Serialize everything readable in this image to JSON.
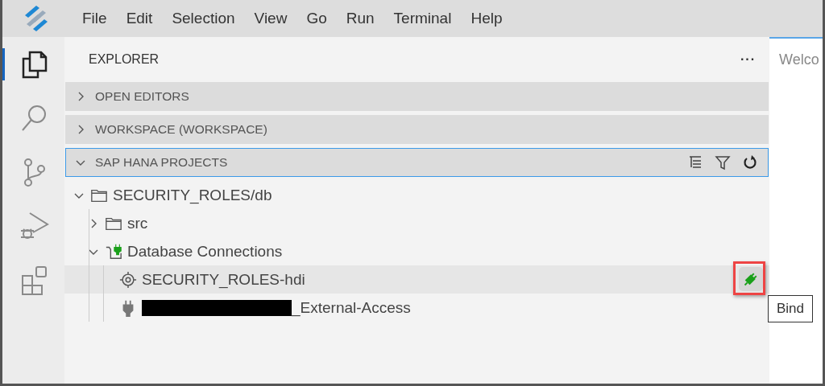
{
  "menu": [
    "File",
    "Edit",
    "Selection",
    "View",
    "Go",
    "Run",
    "Terminal",
    "Help"
  ],
  "activity_bar": [
    {
      "kind": "explorer",
      "selected": true
    },
    {
      "kind": "search",
      "selected": false
    },
    {
      "kind": "source-control",
      "selected": false
    },
    {
      "kind": "debug",
      "selected": false
    },
    {
      "kind": "extensions",
      "selected": false
    }
  ],
  "sidebar": {
    "title": "EXPLORER",
    "more": "···",
    "sections": [
      {
        "title": "OPEN EDITORS",
        "expanded": false,
        "focused": false
      },
      {
        "title": "WORKSPACE (WORKSPACE)",
        "expanded": false,
        "focused": false
      },
      {
        "title": "SAP HANA PROJECTS",
        "expanded": true,
        "focused": true,
        "tree": [
          {
            "kind": "folder",
            "label": "SECURITY_ROLES/db",
            "expanded": true,
            "children": [
              {
                "kind": "folder",
                "label": "src",
                "expanded": false
              },
              {
                "kind": "connections",
                "label": "Database Connections",
                "expanded": true,
                "children": [
                  {
                    "kind": "hdi",
                    "label": "SECURITY_ROLES-hdi",
                    "selected": true,
                    "action": {
                      "tooltip": "Bind"
                    }
                  },
                  {
                    "kind": "plug",
                    "label": "_External-Access",
                    "redacted": true,
                    "selected": false
                  }
                ]
              }
            ]
          }
        ]
      }
    ]
  },
  "editor": {
    "tab_text": "Welco"
  }
}
